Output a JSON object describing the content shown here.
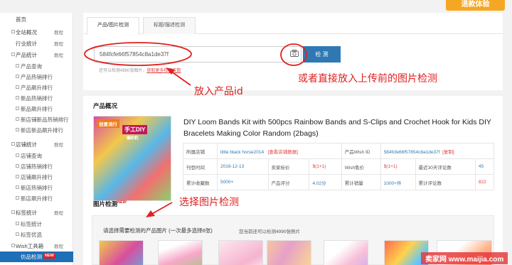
{
  "top_button": "退款体验",
  "sidebar": {
    "items": [
      {
        "label": "首页"
      },
      {
        "label": "全站概况",
        "tutorial": "教程"
      },
      {
        "label": "行业统计",
        "tutorial": "教程"
      },
      {
        "label": "产品统计",
        "tutorial": "教程"
      },
      {
        "label": "产品查询"
      },
      {
        "label": "产品热销排行"
      },
      {
        "label": "产品飙升排行"
      },
      {
        "label": "新品热销排行"
      },
      {
        "label": "新品飙升排行"
      },
      {
        "label": "新店铺新品热销排行"
      },
      {
        "label": "新店新品飙升排行"
      },
      {
        "label": "店铺统计",
        "tutorial": "教程"
      },
      {
        "label": "店铺查询"
      },
      {
        "label": "店铺热销排行"
      },
      {
        "label": "店铺飙升排行"
      },
      {
        "label": "新店热销排行"
      },
      {
        "label": "新店飙升排行"
      },
      {
        "label": "标签统计",
        "tutorial": "教程"
      },
      {
        "label": "标签统计"
      },
      {
        "label": "标签优选"
      },
      {
        "label": "Wish工具箱",
        "tutorial": "教程"
      },
      {
        "label": "仿品检测",
        "badge": "NEW"
      }
    ]
  },
  "tabs": [
    {
      "label": "产品/图片检测"
    },
    {
      "label": "标题/描述检测"
    }
  ],
  "search": {
    "value": "584fcfe66f57854c8a1de37f",
    "button": "检 测",
    "hint_prefix": "还可以检测4990张图片，",
    "hint_link": "获取更多检测次数"
  },
  "annotations": {
    "put_id": "放入产品id",
    "upload": "或者直接放入上传前的图片检测",
    "select": "选择图片检测"
  },
  "overview": {
    "title": "产品概况",
    "image_text": {
      "a": "创意流行",
      "b": "手工DIY",
      "c": "编织机"
    },
    "product_title": "DIY Loom Bands Kit with 500pcs Rainbow Bands and S-Clips and Crochet Hook for Kids DIY Bracelets Making Color Random (2bags)",
    "table": {
      "shop_label": "所属店铺",
      "shop_value": "little black horse2014",
      "shop_link": "[查看店铺数据]",
      "wish_id_label": "产品Wish ID",
      "wish_id_value": "584fcfe66f57854c8a1de37f",
      "copy_link": "[复制]",
      "listed_label": "刊登时间",
      "listed_value": "2016-12-13",
      "seller_price_label": "卖家标价",
      "seller_price_value": "$(1+1)",
      "wish_price_label": "Wish售价",
      "wish_price_value": "$(1+1)",
      "reviews30_label": "最近30天评论数",
      "reviews30_value": "45",
      "favs_label": "累计收藏数",
      "favs_value": "5000+",
      "rating_label": "产品评分",
      "rating_value": "4.02分",
      "sales_label": "累计销量",
      "sales_value": "1000+件",
      "reviews_label": "累计评论数",
      "reviews_value": "822"
    }
  },
  "image_detect": {
    "title": "图片检测",
    "badge": "NEW",
    "instruction": "请选择需要检测的产品图片 (一次最多选择6张)",
    "remaining": "您当前还可以检测4990张照片"
  },
  "watermark": "卖家网 www.maijia.com",
  "colors": {
    "accent": "#2f78b4",
    "annotation": "#e02020",
    "cta": "#f5a623"
  }
}
